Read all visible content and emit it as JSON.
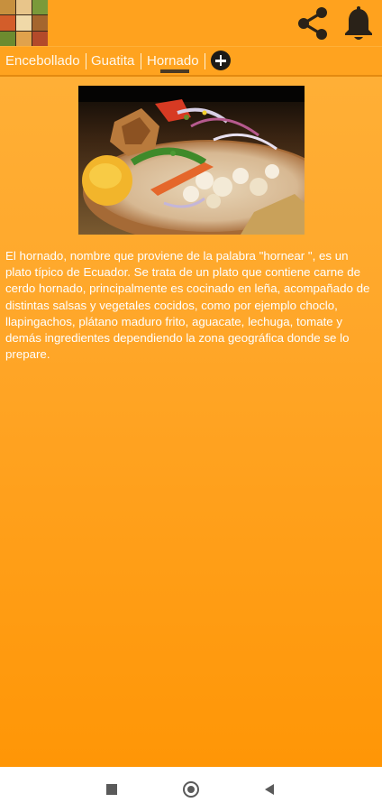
{
  "top_bar": {
    "app_icon": "food-collage-icon",
    "share_icon": "share-icon",
    "notification_icon": "bell-icon"
  },
  "tabs": [
    {
      "label": "Encebollado"
    },
    {
      "label": "Guatita"
    },
    {
      "label": "Hornado",
      "selected": true
    }
  ],
  "add_tab_icon": "plus-circle-icon",
  "food_image": "hornado-plate-photo",
  "description": "El hornado, nombre que proviene de la palabra \"hornear \", es un plato típico de Ecuador. Se trata de un plato que contiene carne de cerdo hornado, principalmente es cocinado en leña, acompañado de distintas salsas y vegetales cocidos, como por ejemplo choclo, llapingachos, plátano maduro frito, aguacate, lechuga, tomate y demás ingredientes dependiendo la zona geográfica donde se lo prepare.",
  "nav_bar": {
    "recent": "square-icon",
    "home": "circle-icon",
    "back": "back-triangle-icon"
  },
  "colors": {
    "background_top": "#ffb23a",
    "background_bottom": "#ff9606",
    "tab_indicator": "#4a3a25",
    "text": "#ffffff"
  }
}
